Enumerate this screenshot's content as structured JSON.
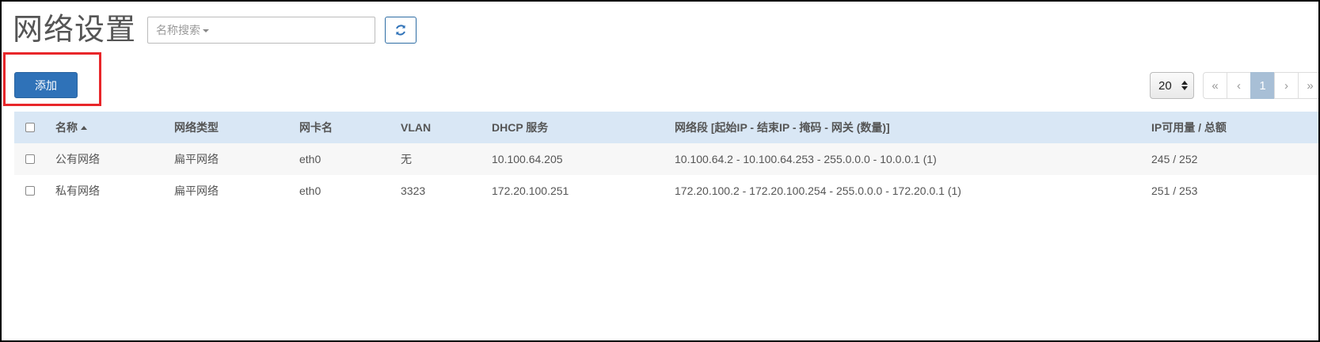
{
  "page": {
    "title": "网络设置"
  },
  "search": {
    "placeholder": "名称搜索"
  },
  "toolbar": {
    "refresh_icon": "refresh-icon",
    "add_label": "添加",
    "page_size": "20"
  },
  "pagination": {
    "first": "«",
    "prev": "‹",
    "current": "1",
    "next": "›",
    "last": "»"
  },
  "colors": {
    "primary": "#2f72b8",
    "header_bg": "#d9e7f5",
    "highlight": "#e8262a",
    "active_page": "#a8bfd6"
  },
  "table": {
    "columns": [
      "名称",
      "网络类型",
      "网卡名",
      "VLAN",
      "DHCP 服务",
      "网络段 [起始IP - 结束IP - 掩码 - 网关 (数量)]",
      "IP可用量 / 总额"
    ],
    "sort_column": "名称",
    "rows": [
      {
        "name": "公有网络",
        "type": "扁平网络",
        "nic": "eth0",
        "vlan": "无",
        "dhcp": "10.100.64.205",
        "segment": "10.100.64.2 - 10.100.64.253 - 255.0.0.0 - 10.0.0.1 (1)",
        "usage": "245 / 252"
      },
      {
        "name": "私有网络",
        "type": "扁平网络",
        "nic": "eth0",
        "vlan": "3323",
        "dhcp": "172.20.100.251",
        "segment": "172.20.100.2 - 172.20.100.254 - 255.0.0.0 - 172.20.0.1 (1)",
        "usage": "251 / 253"
      }
    ]
  }
}
